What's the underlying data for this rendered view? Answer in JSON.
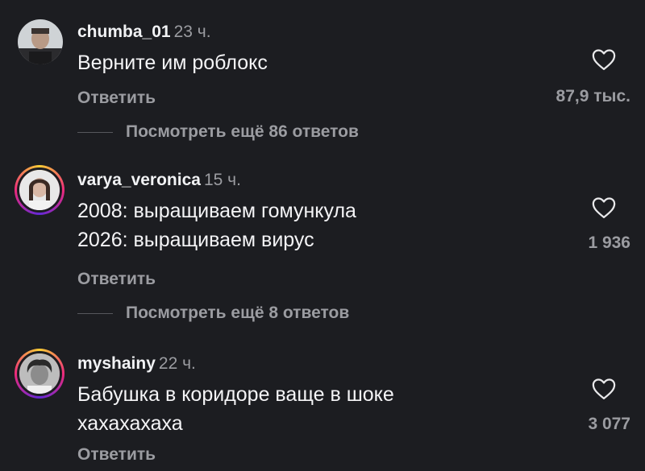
{
  "comments": [
    {
      "username": "chumba_01",
      "time": "23 ч.",
      "lines": [
        "Верните им роблокс"
      ],
      "reply_label": "Ответить",
      "likes": "87,9 тыс.",
      "more_replies": "Посмотреть ещё 86 ответов"
    },
    {
      "username": "varya_veronica",
      "time": "15 ч.",
      "lines": [
        "2008: выращиваем гомункула",
        "2026: выращиваем вирус"
      ],
      "reply_label": "Ответить",
      "likes": "1 936",
      "more_replies": "Посмотреть ещё 8 ответов"
    },
    {
      "username": "myshainy",
      "time": "22 ч.",
      "lines": [
        "Бабушка в коридоре ваще в шоке",
        "хахахахаха"
      ],
      "reply_label": "Ответить",
      "likes": "3 077"
    }
  ],
  "colors": {
    "background": "#1c1d21",
    "primary_text": "#f1f2f4",
    "secondary_text": "#9b9ca1",
    "story_ring": [
      "#f9ce34",
      "#ee2a7b",
      "#6228d7"
    ]
  },
  "icons": {
    "like": "heart-outline-icon"
  }
}
